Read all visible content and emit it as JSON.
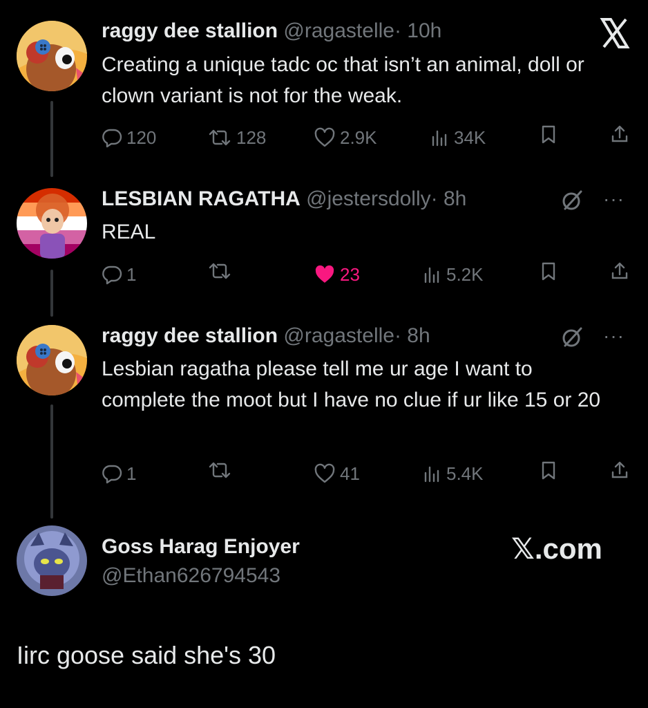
{
  "header": {
    "x_logo": "𝕏"
  },
  "tweets": [
    {
      "name": "raggy dee stallion",
      "handle": "@ragastelle",
      "time": "· 10h",
      "text": "Creating a unique tadc oc that isn’t an animal, doll or clown variant is not for the weak.",
      "replies": "120",
      "retweets": "128",
      "likes": "2.9K",
      "views": "34K",
      "liked": false
    },
    {
      "name": "LESBIAN RAGATHA",
      "handle": "@jestersdolly",
      "time": "· 8h",
      "text": "REAL",
      "replies": "1",
      "retweets": "",
      "likes": "23",
      "views": "5.2K",
      "liked": true
    },
    {
      "name": "raggy dee stallion",
      "handle": "@ragastelle",
      "time": "· 8h",
      "text": "Lesbian ragatha please tell me ur age I want to complete the moot but I have no clue if ur like 15 or 20",
      "replies": "1",
      "retweets": "",
      "likes": "41",
      "views": "5.4K",
      "liked": false
    }
  ],
  "reply_card": {
    "name": "Goss Harag Enjoyer",
    "handle": "@Ethan626794543",
    "brand": "𝕏.com",
    "text": "Iirc goose said she's 30"
  },
  "colors": {
    "background": "#000000",
    "text": "#e7e9ea",
    "muted": "#71767b",
    "like": "#f91880"
  },
  "icons": [
    "x-logo-icon",
    "grok-icon",
    "more-icon",
    "reply-icon",
    "retweet-icon",
    "like-icon",
    "views-icon",
    "bookmark-icon",
    "share-icon"
  ]
}
